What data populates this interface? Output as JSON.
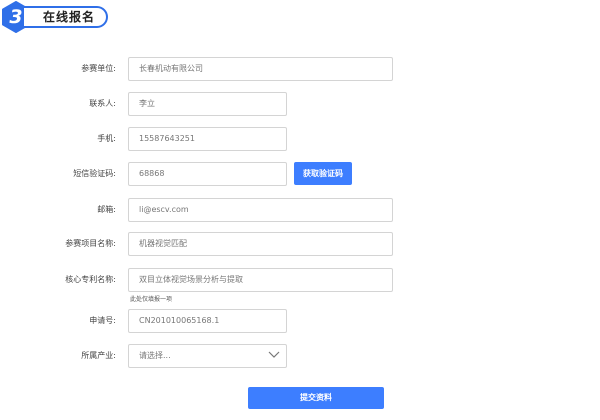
{
  "header": {
    "step": "3",
    "title": "在线报名"
  },
  "form": {
    "unit": {
      "label": "参赛单位:",
      "value": "长春机动有限公司"
    },
    "contact": {
      "label": "联系人:",
      "value": "李立"
    },
    "phone": {
      "label": "手机:",
      "value": "15587643251"
    },
    "sms": {
      "label": "短信验证码:",
      "value": "68868",
      "button": "获取验证码"
    },
    "email": {
      "label": "邮箱:",
      "value": "li@escv.com"
    },
    "project": {
      "label": "参赛项目名称:",
      "value": "机器视觉匹配"
    },
    "patent": {
      "label": "核心专利名称:",
      "value": "双目立体视觉场景分析与提取",
      "hint": "此处仅填报一项"
    },
    "application": {
      "label": "申请号:",
      "value": "CN201010065168.1"
    },
    "industry": {
      "label": "所属产业:",
      "value": "请选择..."
    },
    "submit": "提交资料"
  },
  "colors": {
    "accent": "#3d7eff",
    "border": "#d4d4d4"
  }
}
